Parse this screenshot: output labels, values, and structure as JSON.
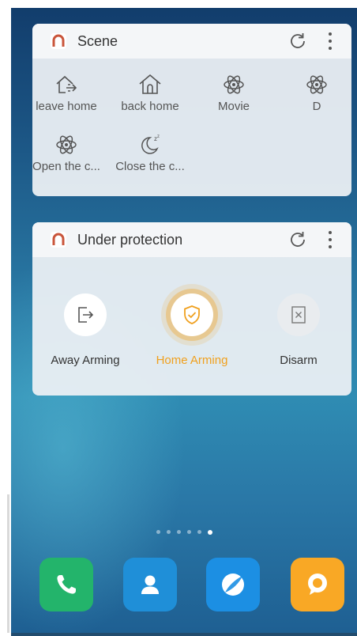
{
  "scene_widget": {
    "title": "Scene",
    "items": [
      {
        "label": "leave home",
        "icon": "leave-home-icon"
      },
      {
        "label": "back home",
        "icon": "back-home-icon"
      },
      {
        "label": "Movie",
        "icon": "atom-icon"
      },
      {
        "label": "D",
        "icon": "atom-icon"
      },
      {
        "label": "Open the c...",
        "icon": "atom-icon"
      },
      {
        "label": "Close the c...",
        "icon": "moon-sleep-icon"
      }
    ]
  },
  "protection_widget": {
    "title": "Under protection",
    "modes": [
      {
        "label": "Away Arming",
        "icon": "exit-door-icon",
        "active": false
      },
      {
        "label": "Home Arming",
        "icon": "shield-check-icon",
        "active": true
      },
      {
        "label": "Disarm",
        "icon": "disarm-x-icon",
        "active": false
      }
    ]
  },
  "page_indicator": {
    "pages": 6,
    "active_index": 5
  },
  "dock": [
    {
      "name": "phone",
      "icon": "phone-icon",
      "color": "#23b46b"
    },
    {
      "name": "contacts",
      "icon": "contacts-icon",
      "color": "#1f8fd8"
    },
    {
      "name": "browser",
      "icon": "browser-icon",
      "color": "#1c8fe3"
    },
    {
      "name": "messages",
      "icon": "messages-icon",
      "color": "#f9a825"
    }
  ],
  "colors": {
    "accent_orange": "#f0a01e",
    "widget_bg": "#eef1f4",
    "text_dark": "#333333"
  }
}
